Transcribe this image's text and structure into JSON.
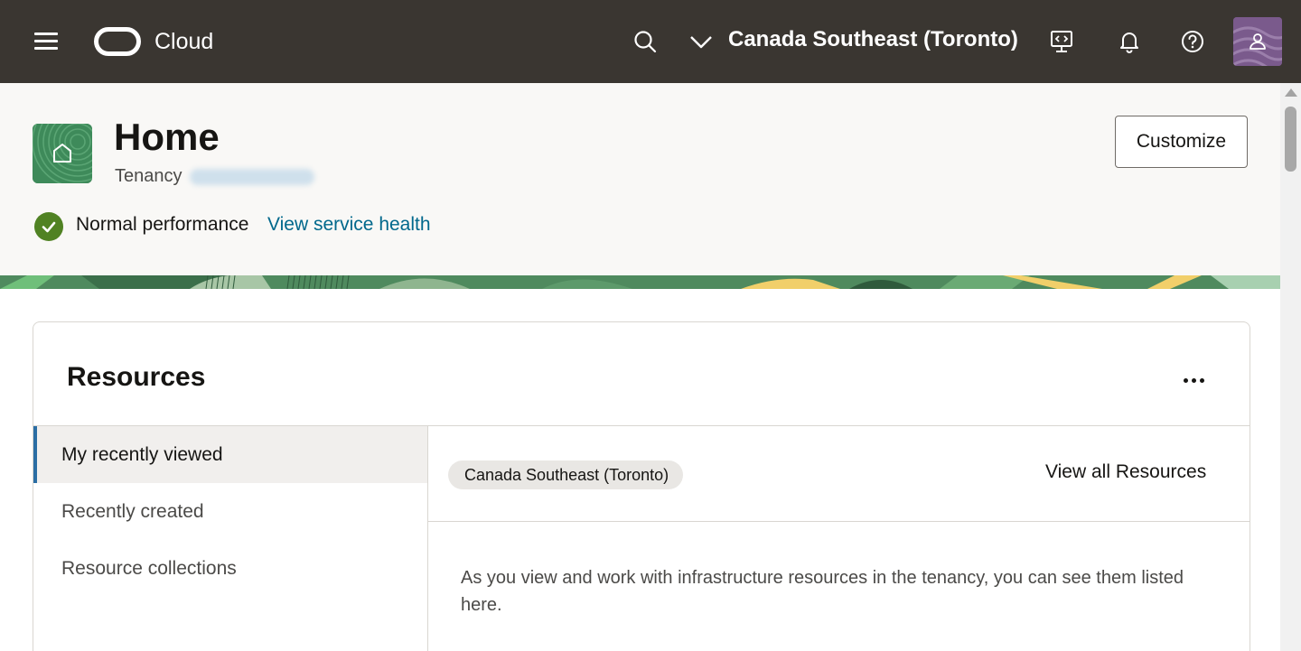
{
  "topbar": {
    "brand": "Cloud",
    "region": "Canada Southeast (Toronto)",
    "icons": [
      "hamburger-menu-icon",
      "oracle-logo-icon",
      "search-icon",
      "chevron-down-icon",
      "developer-tools-icon",
      "bell-icon",
      "help-icon",
      "user-icon"
    ],
    "background": "#3a3631"
  },
  "header": {
    "title": "Home",
    "tenancy_label": "Tenancy",
    "performance_text": "Normal performance",
    "health_link": "View service health",
    "customize_label": "Customize",
    "status_color": "#508223",
    "link_color": "#00688c"
  },
  "resources": {
    "title": "Resources",
    "nav": [
      {
        "label": "My recently viewed",
        "active": true
      },
      {
        "label": "Recently created",
        "active": false
      },
      {
        "label": "Resource collections",
        "active": false
      }
    ],
    "region_chip": "Canada Southeast (Toronto)",
    "view_all": "View all Resources",
    "empty_message": "As you view and work with infrastructure resources in the tenancy, you can see them listed here."
  }
}
